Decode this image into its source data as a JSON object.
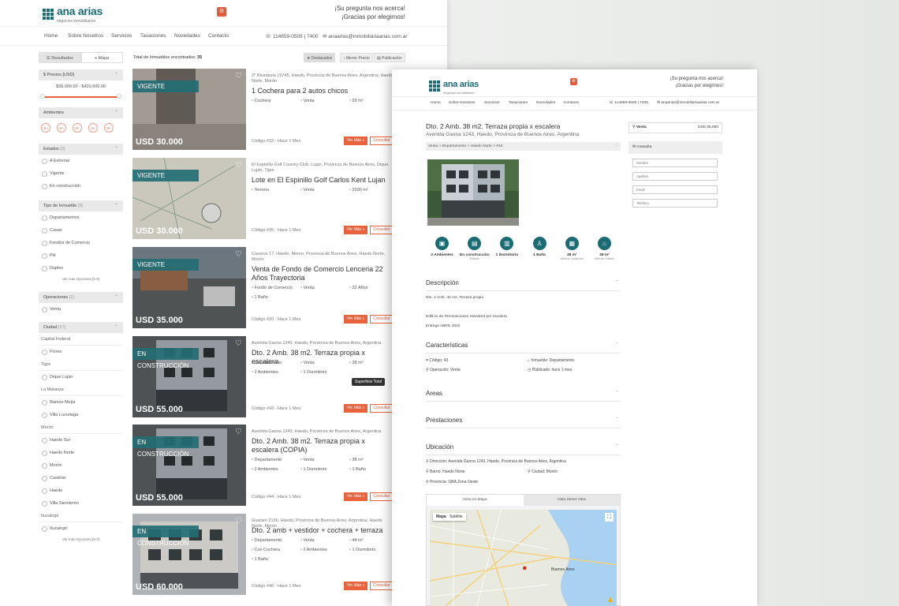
{
  "brand": {
    "name": "ana arias",
    "sub": "negocios inmobiliarios",
    "tag1": "¡Su pregunta nos acerca!",
    "tag2": "¡Gracias por elegirnos!"
  },
  "nav": {
    "items": [
      "Home",
      "Sobre Nosotros",
      "Servicios",
      "Tasaciones",
      "Novedades",
      "Contacto"
    ],
    "phone": "114659-0505 | 7400",
    "email": "anaarias@inmobiliariaarias.com.ar"
  },
  "list": {
    "tabs": [
      "Resultados",
      "Mapa"
    ],
    "total_label": "Total de Inmuebles encontrados:",
    "total": "35",
    "sort": [
      "Destacados",
      "Menor Precio",
      "Publicación"
    ],
    "filters": {
      "precio": {
        "title": "Precios [USD]",
        "range": "$30,000.00 - $420,000.00"
      },
      "ambientes": {
        "title": "Ambientes",
        "opts": [
          "1+",
          "2+",
          "3+",
          "4+",
          "5+"
        ]
      },
      "estados": {
        "title": "Estados",
        "count": "[3]",
        "opts": [
          "A Estrenar",
          "Vigente",
          "En construcción"
        ]
      },
      "tipo": {
        "title": "Tipo de Inmueble",
        "count": "[9]",
        "opts": [
          "Departamentos",
          "Casas",
          "Fondos de Comercio",
          "PH",
          "Duplex"
        ],
        "more": "Ver más Opciones [5-9]"
      },
      "operaciones": {
        "title": "Operaciones",
        "count": "[1]",
        "opts": [
          "Venta"
        ]
      },
      "ciudad": {
        "title": "Ciudad",
        "count": "[17]",
        "groups": [
          {
            "name": "Capital Federal",
            "items": [
              "Flores"
            ]
          },
          {
            "name": "Tigre",
            "items": [
              "Dique Luján"
            ]
          },
          {
            "name": "La Matanza",
            "items": [
              "Ramos Mejía",
              "Villa Luzuriaga"
            ]
          },
          {
            "name": "Morón",
            "items": [
              "Haedo Sur",
              "Haedo Norte",
              "Morón",
              "Castelar",
              "Haedo",
              "Villa Sarmiento"
            ]
          },
          {
            "name": "Ituzaingó",
            "items": [
              "Ituzaingó"
            ]
          }
        ],
        "more": "Ver más Opciones [5-7]"
      }
    },
    "cards": [
      {
        "ribbon": "VIGENTE",
        "price": "USD 30.000",
        "addr": "2º Rivadavia 15745, Haedo, Provincia de Buenos Aires, Argentina, Haedo Norte, Morón",
        "title": "1 Cochera para 2 autos chicos",
        "f": [
          "Cochera",
          "Venta",
          "29 m²"
        ],
        "code": "Código #32 - Hace 1 Mes"
      },
      {
        "ribbon": "VIGENTE",
        "price": "USD 30.000",
        "addr": "El Espinillo Golf Country Club, Luján, Provincia de Buenos Aires, Dique Luján, Tigre",
        "title": "Lote en El Espinillo Golf Carlos Kent Lujan",
        "f": [
          "Terreno",
          "Venta",
          "2000 m²"
        ],
        "code": "Código #35 - Hace 1 Mes"
      },
      {
        "ribbon": "VIGENTE",
        "price": "USD 35.000",
        "addr": "Caseros 17, Haedo, Moron, Provincia de Buenos Aires, Haedo Norte, Morón",
        "title": "Venta de Fondo de Comercio Lenceria 22 Años Trayectoria",
        "f": [
          "Fondo de Comercio",
          "Venta",
          "22 Años",
          "1 Baño"
        ],
        "code": "Código #20 - Hace 1 Mes"
      },
      {
        "ribbon": "EN CONSTRUCCIÓN",
        "price": "USD 55.000",
        "addr": "Avenida Gaona 1243, Haedo, Provincia de Buenos Aires, Argentina",
        "title": "Dto. 2 Amb. 38 m2. Terraza propia x escalera",
        "f": [
          "Departamento",
          "Venta",
          "38 m²",
          "2 Ambientes",
          "1 Dormitorio"
        ],
        "code": "Código #43 - Hace 1 Mes"
      },
      {
        "ribbon": "EN CONSTRUCCIÓN",
        "price": "USD 55.000",
        "addr": "Avenida Gaona 1243, Haedo, Provincia de Buenos Aires, Argentina",
        "title": "Dto. 2 Amb. 38 m2. Terraza propia x escalera (COPIA)",
        "f": [
          "Departamento",
          "Venta",
          "38 m²",
          "2 Ambientes",
          "1 Dormitorio",
          "1 Baño"
        ],
        "code": "Código #44 - Hace 1 Mes"
      },
      {
        "ribbon": "EN CONSTRUCCIÓN",
        "price": "USD 60.000",
        "addr": "Guaraní 2136, Haedo, Provincia de Buenos Aires, Argentina, Haedo Norte, Morón",
        "title": "Dto. 2 amb + vestidor + cochera + terraza",
        "f": [
          "Departamento",
          "Venta",
          "44 m²",
          "Con Cochera",
          "2 Ambientes",
          "1 Dormitorio",
          "1 Baño"
        ],
        "code": "Código #46 - Hace 1 Mes"
      }
    ],
    "btn_more": "Ver Más",
    "btn_consult": "Consultar",
    "tooltip": "Superficie Total"
  },
  "detail": {
    "title": "Dto. 2 Amb. 38 m2. Terraza propia x escalera",
    "addr": "Avenida Gaona 1243, Haedo, Provincia de Buenos Aires, Argentina",
    "breadcrumb": "Venta  >  Departamento  >  Haedo Norte  >  #43",
    "icons": [
      {
        "l": "2 Ambientes",
        "s": ""
      },
      {
        "l": "En construcción",
        "s": "Estado"
      },
      {
        "l": "1 Dormitorio",
        "s": ""
      },
      {
        "l": "1 Baño",
        "s": ""
      },
      {
        "l": "38 m²",
        "s": "Metros Cubiertos"
      },
      {
        "l": "38 m²",
        "s": "Metros Totales"
      }
    ],
    "desc_title": "Descripción",
    "desc": [
      "Dto. 2 Amb. 40 m2. Terraza propia",
      "Edificio de Terminaciones Standard por escalera",
      "Entrega ABRIL 2022"
    ],
    "car_title": "Características",
    "car": [
      "Código: 43",
      "Inmueble: Departamento",
      "Operación: Venta",
      "Publicado: hace 1 mes"
    ],
    "areas": "Areas",
    "prest": "Prestaciones",
    "ubic": "Ubicación",
    "ubi": [
      "Dirección: Avenida Gaona 1243, Haedo, Provincia de Buenos Aires, Argentina",
      "Barrio: Haedo Norte",
      "Ciudad: Morón",
      "Provincia: GBA Zona Oeste"
    ],
    "map_tabs": [
      "Vista en Mapa",
      "Vista Street View"
    ],
    "map_types": [
      "Mapa",
      "Satélite"
    ],
    "map_label": "Buenos Aires",
    "side": {
      "venta": "Venta",
      "price": "USD 55,000",
      "consulta": "Consulta",
      "fields": [
        "Nombre",
        "Apellido",
        "Email",
        "Teléfono"
      ]
    }
  },
  "colors": {
    "teal": "#1a6c74",
    "orange": "#e8623d"
  }
}
